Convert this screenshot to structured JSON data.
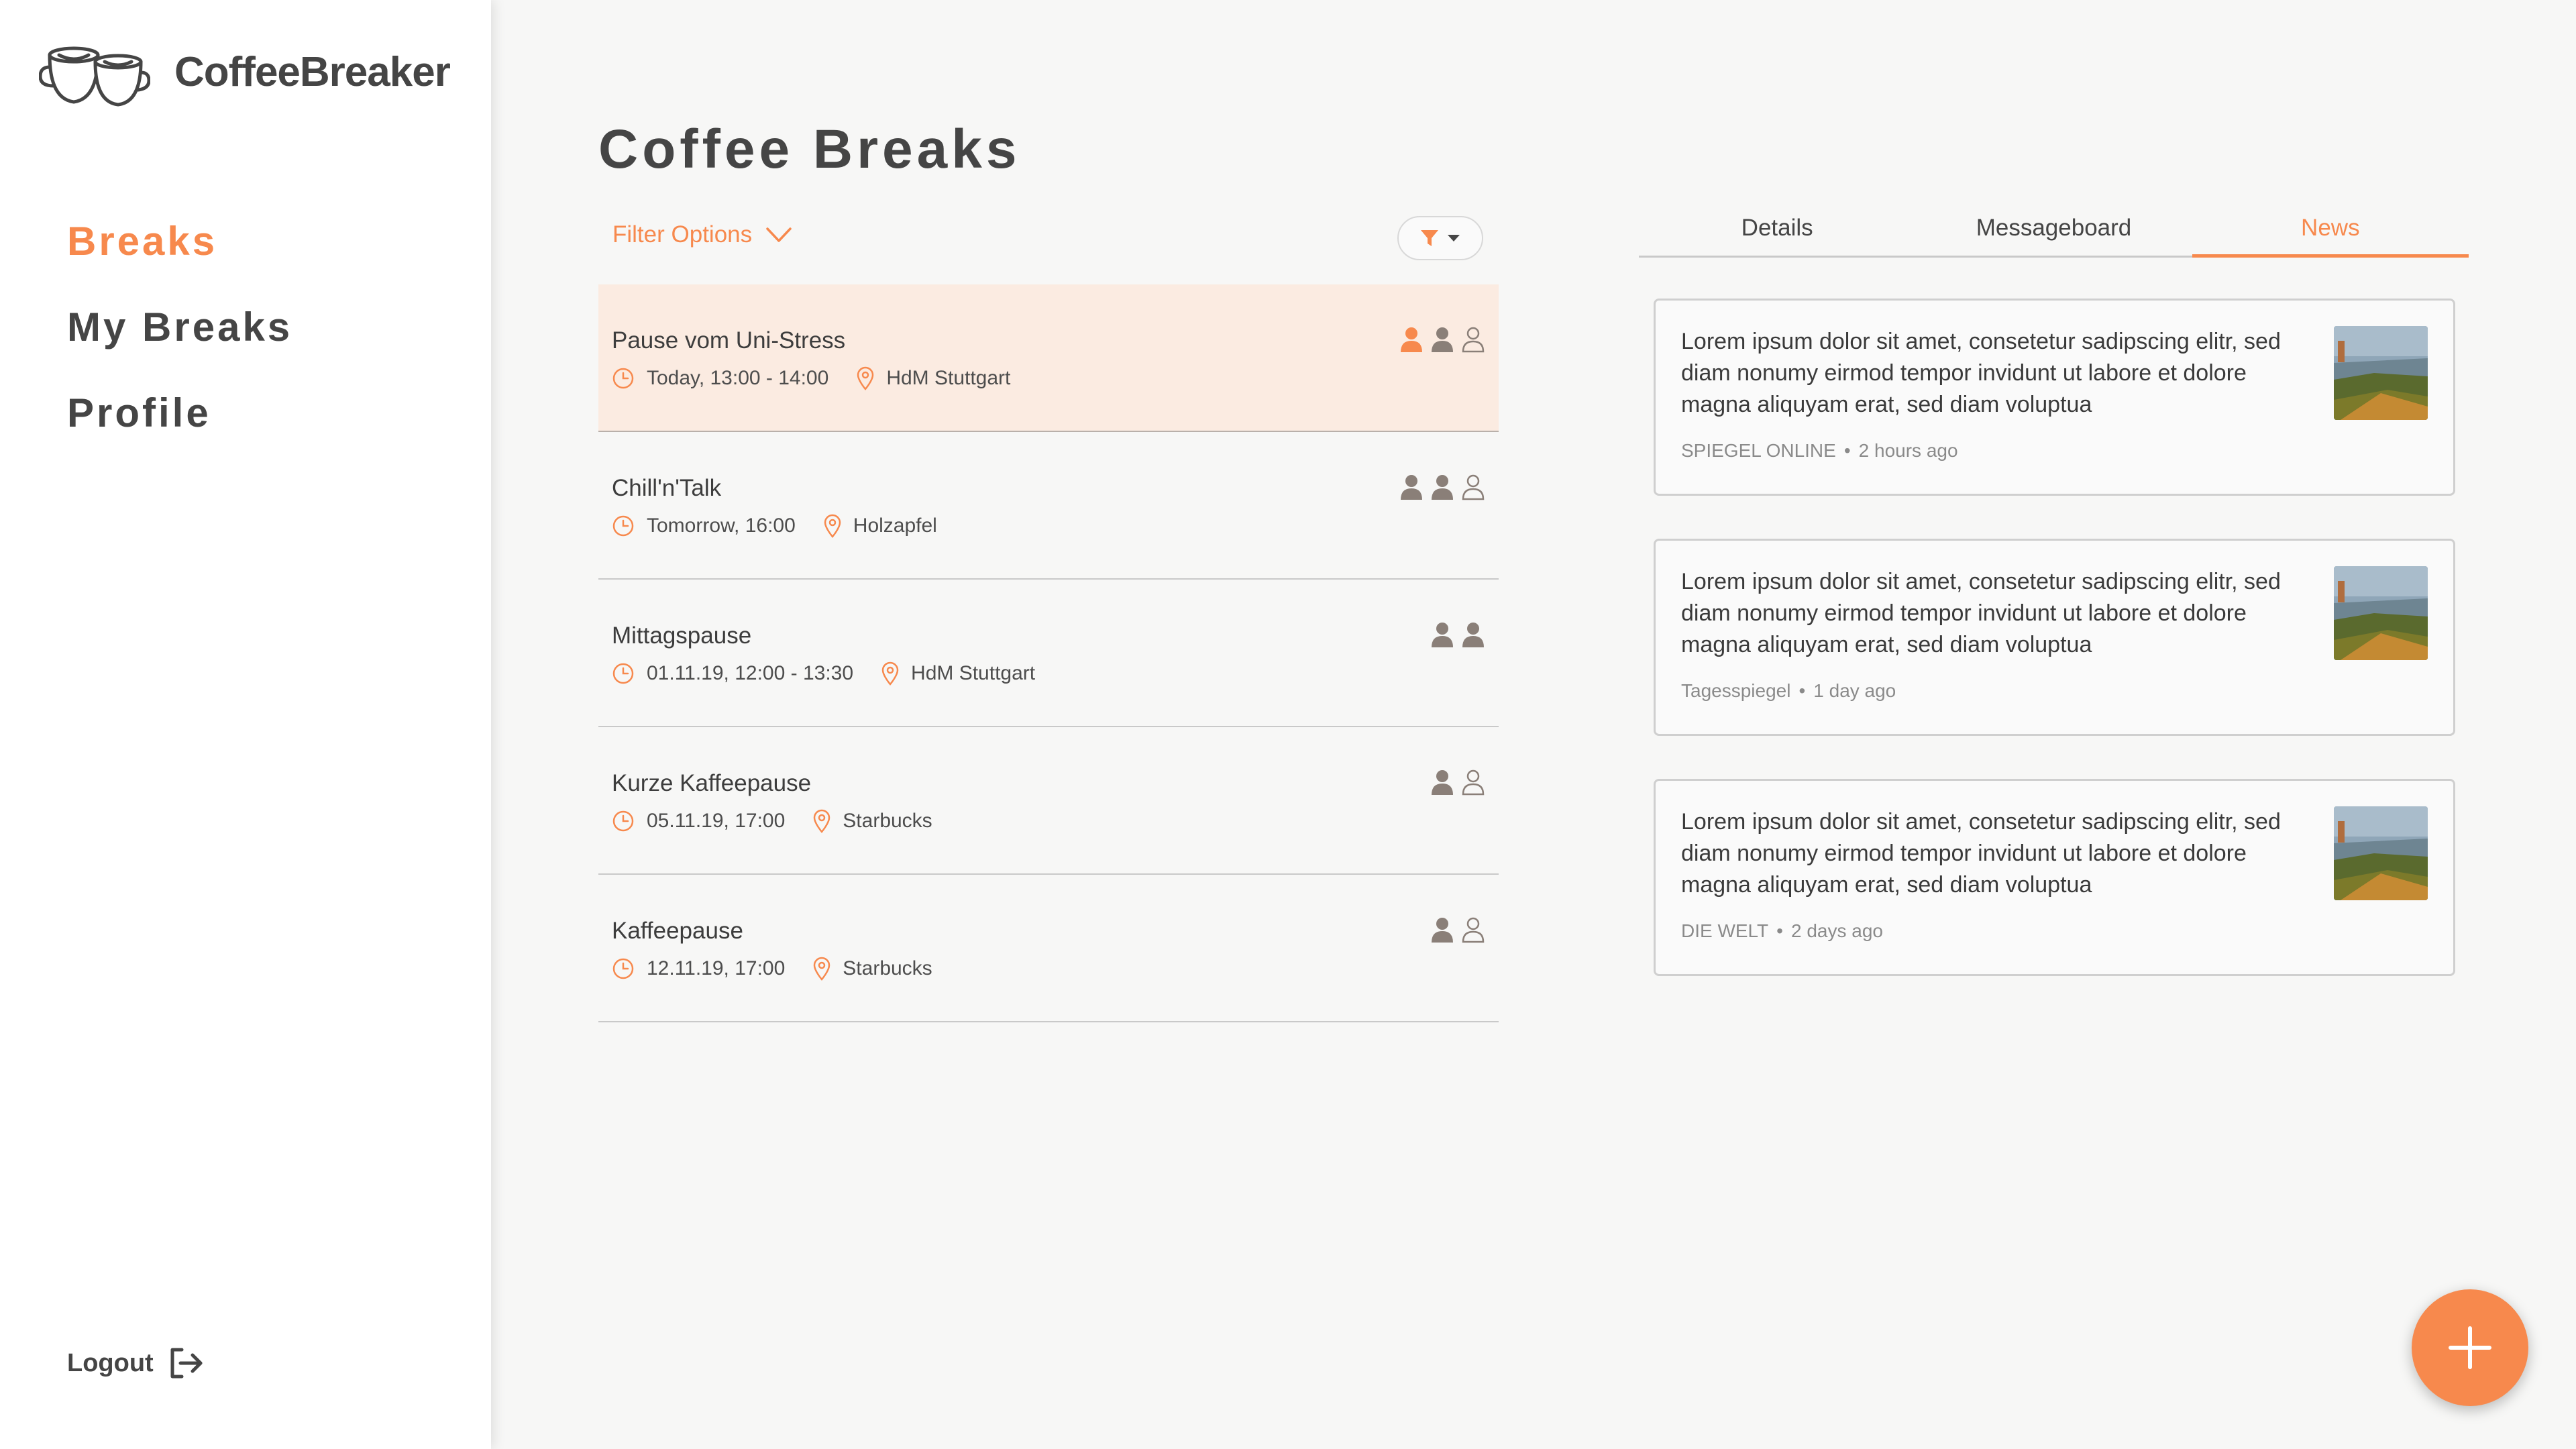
{
  "app": {
    "name": "CoffeeBreaker"
  },
  "nav": {
    "items": [
      {
        "label": "Breaks",
        "active": true
      },
      {
        "label": "My Breaks",
        "active": false
      },
      {
        "label": "Profile",
        "active": false
      }
    ],
    "logout_label": "Logout"
  },
  "page": {
    "title": "Coffee Breaks"
  },
  "filter": {
    "label": "Filter Options"
  },
  "breaks": [
    {
      "name": "Pause vom Uni-Stress",
      "time": "Today, 13:00 - 14:00",
      "location": "HdM Stuttgart",
      "selected": true
    },
    {
      "name": "Chill'n'Talk",
      "time": "Tomorrow, 16:00",
      "location": "Holzapfel",
      "selected": false
    },
    {
      "name": "Mittagspause",
      "time": "01.11.19, 12:00 - 13:30",
      "location": "HdM Stuttgart",
      "selected": false
    },
    {
      "name": "Kurze Kaffeepause",
      "time": "05.11.19, 17:00",
      "location": "Starbucks",
      "selected": false
    },
    {
      "name": "Kaffeepause",
      "time": "12.11.19, 17:00",
      "location": "Starbucks",
      "selected": false
    }
  ],
  "tabs": [
    {
      "label": "Details",
      "active": false
    },
    {
      "label": "Messageboard",
      "active": false
    },
    {
      "label": "News",
      "active": true
    }
  ],
  "news": [
    {
      "text": "Lorem ipsum dolor sit amet, consetetur sadipscing elitr, sed diam nonumy eirmod tempor invidunt ut labore et dolore magna aliquyam erat, sed diam voluptua",
      "source": "SPIEGEL ONLINE",
      "age": "2 hours ago"
    },
    {
      "text": "Lorem ipsum dolor sit amet, consetetur sadipscing elitr, sed diam nonumy eirmod tempor invidunt ut labore et dolore magna aliquyam erat, sed diam voluptua",
      "source": "Tagesspiegel",
      "age": "1 day ago"
    },
    {
      "text": "Lorem ipsum dolor sit amet, consetetur sadipscing elitr, sed diam nonumy eirmod tempor invidunt ut labore et dolore magna aliquyam erat, sed diam voluptua",
      "source": "DIE WELT",
      "age": "2 days ago"
    }
  ],
  "colors": {
    "accent": "#f7894d",
    "text": "#454545",
    "selected_row": "#fbebe1",
    "participant": "#8a7f78"
  },
  "icons": {
    "logo": "coffee-cups-icon",
    "logout": "logout-icon",
    "clock": "clock-icon",
    "pin": "location-pin-icon",
    "person": "person-icon",
    "filter": "funnel-icon",
    "add": "plus-icon"
  }
}
